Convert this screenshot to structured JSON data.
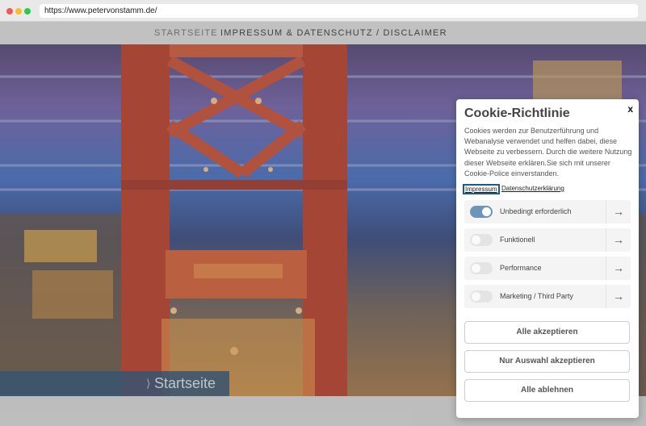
{
  "browser": {
    "url": "https://www.petervonstamm.de/"
  },
  "nav": {
    "home": "STARTSEITE",
    "impressum": "IMPRESSUM & DATENSCHUTZ / DISCLAIMER"
  },
  "hero": {
    "banner_chevron": "⟩",
    "banner_text": "Startseite"
  },
  "cookie": {
    "close": "x",
    "title": "Cookie-Richtlinie",
    "text": "Cookies werden zur Benutzerführung und Webanalyse verwendet und helfen dabei, diese Webseite zu verbessern. Durch die weitere Nutzung dieser Webseite erklären.Sie sich mit unserer Cookie-Police einverstanden.",
    "links": {
      "impressum": "Impressum",
      "datenschutz": "Datenschutzerklärung"
    },
    "categories": [
      {
        "label": "Unbedingt erforderlich",
        "enabled": true
      },
      {
        "label": "Funktionell",
        "enabled": false
      },
      {
        "label": "Performance",
        "enabled": false
      },
      {
        "label": "Marketing / Third Party",
        "enabled": false
      }
    ],
    "arrow": "→",
    "buttons": {
      "accept_all": "Alle akzeptieren",
      "accept_selection": "Nur Auswahl akzeptieren",
      "reject_all": "Alle ablehnen"
    }
  }
}
